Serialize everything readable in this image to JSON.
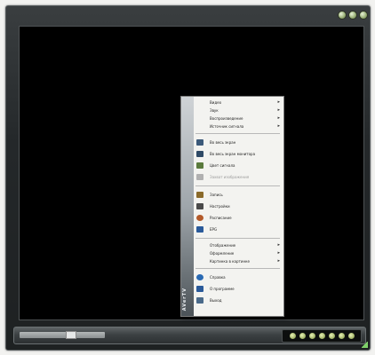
{
  "menu": {
    "submenus_top": [
      {
        "label": "Видео"
      },
      {
        "label": "Звук"
      },
      {
        "label": "Воспроизведение"
      },
      {
        "label": "Источник сигнала"
      }
    ],
    "actions_1": [
      {
        "label": "Во весь экран",
        "icon": "fullscreen-icon",
        "color": "#3c5a7a"
      },
      {
        "label": "Во весь экран монитора",
        "icon": "monitor-icon",
        "color": "#2f4a66"
      },
      {
        "label": "Цвет сигнала",
        "icon": "color-icon",
        "color": "#5a7a3c"
      },
      {
        "label": "Захват изображения",
        "icon": "capture-icon",
        "color": "#8a8a8a",
        "disabled": true
      }
    ],
    "actions_2": [
      {
        "label": "Запись",
        "icon": "record-icon",
        "color": "#8a6a2a"
      },
      {
        "label": "Настройки",
        "icon": "settings-icon",
        "color": "#4a4a4a"
      },
      {
        "label": "Расписание",
        "icon": "schedule-icon",
        "color": "#b35a2a"
      },
      {
        "label": "EPG",
        "icon": "epg-icon",
        "color": "#2a5a9a"
      }
    ],
    "submenus_bottom": [
      {
        "label": "Отображение"
      },
      {
        "label": "Оформление"
      },
      {
        "label": "Картинка в картинке"
      }
    ],
    "actions_3": [
      {
        "label": "Справка",
        "icon": "help-icon",
        "color": "#2a6ab3"
      },
      {
        "label": "О программе",
        "icon": "info-icon",
        "color": "#2a5a9a"
      },
      {
        "label": "Выход",
        "icon": "exit-icon",
        "color": "#4a6a8a"
      }
    ],
    "stripe_text": "AVerTV"
  },
  "window_buttons": [
    "minimize",
    "maximize",
    "close"
  ],
  "colors": {
    "accent": "#9db37a",
    "video_bg": "#000000",
    "menu_bg": "#f3f3f0"
  }
}
